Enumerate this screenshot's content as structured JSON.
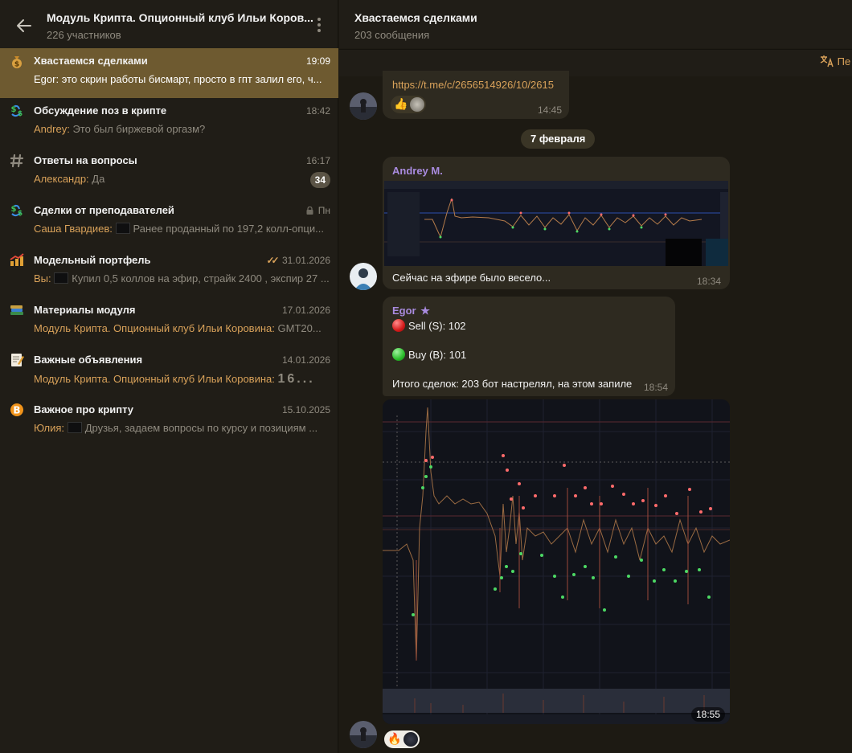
{
  "left_header": {
    "title": "Модуль Крипта. Опционный клуб Ильи Коров...",
    "subtitle": "226 участников"
  },
  "topics": [
    {
      "icon": "money-bag-icon",
      "title": "Хвастаемся сделками",
      "time": "19:09",
      "sender": "Egor:",
      "preview": "это скрин работы бисмарт, просто в гпт залил его, ч...",
      "active": true
    },
    {
      "icon": "currency-exchange-icon",
      "title": "Обсуждение поз в крипте",
      "time": "18:42",
      "sender": "Andrey:",
      "preview": "Это был биржевой оргазм?"
    },
    {
      "icon": "hash-icon",
      "title": "Ответы на вопросы",
      "time": "16:17",
      "sender": "Александр:",
      "preview": "Да",
      "badge": "34"
    },
    {
      "icon": "currency-exchange-icon",
      "title": "Сделки от преподавателей",
      "time": "Пн",
      "sender": "Саша Гвардиев:",
      "preview": "Ранее проданный по 197,2 колл-опци...",
      "locked": true
    },
    {
      "icon": "chart-up-icon",
      "title": "Модельный портфель",
      "time": "31.01.2026",
      "sender": "Вы:",
      "preview": "Купил 0,5 коллов на эфир, страйк 2400 , экспир 27 ...",
      "read": true
    },
    {
      "icon": "books-icon",
      "title": "Материалы модуля",
      "time": "17.01.2026",
      "sender": "Модуль Крипта. Опционный клуб Ильи Коровина:",
      "preview": "GMT20..."
    },
    {
      "icon": "memo-icon",
      "title": "Важные объявления",
      "time": "14.01.2026",
      "sender": "Модуль Крипта. Опционный клуб Ильи Коровина:",
      "preview": "16..."
    },
    {
      "icon": "bitcoin-icon",
      "title": "Важное про крипту",
      "time": "15.10.2025",
      "sender": "Юлия:",
      "preview": "Друзья, задаем вопросы по курсу и позициям ..."
    }
  ],
  "right_header": {
    "title": "Хвастаемся сделками",
    "subtitle": "203 сообщения"
  },
  "translate_label": "Пе",
  "messages": {
    "m1": {
      "link": "https://t.me/c/2656514926/10/2615",
      "time": "14:45"
    },
    "date_separator": "7 февраля",
    "m2": {
      "sender": "Andrey M.",
      "text": "Сейчас на эфире было весело...",
      "time": "18:34"
    },
    "m3": {
      "sender": "Egor",
      "sell": "Sell (S): 102",
      "buy": "Buy (B): 101",
      "total": "Итого сделок: 203 бот настрелял, на этом запиле",
      "time": "18:54"
    },
    "m4": {
      "time": "18:55"
    }
  },
  "colors": {
    "active_topic": "#6e5a30",
    "accent": "#d9a25a",
    "sender_name": "#a98bdf",
    "bubble": "#2e2a20"
  }
}
